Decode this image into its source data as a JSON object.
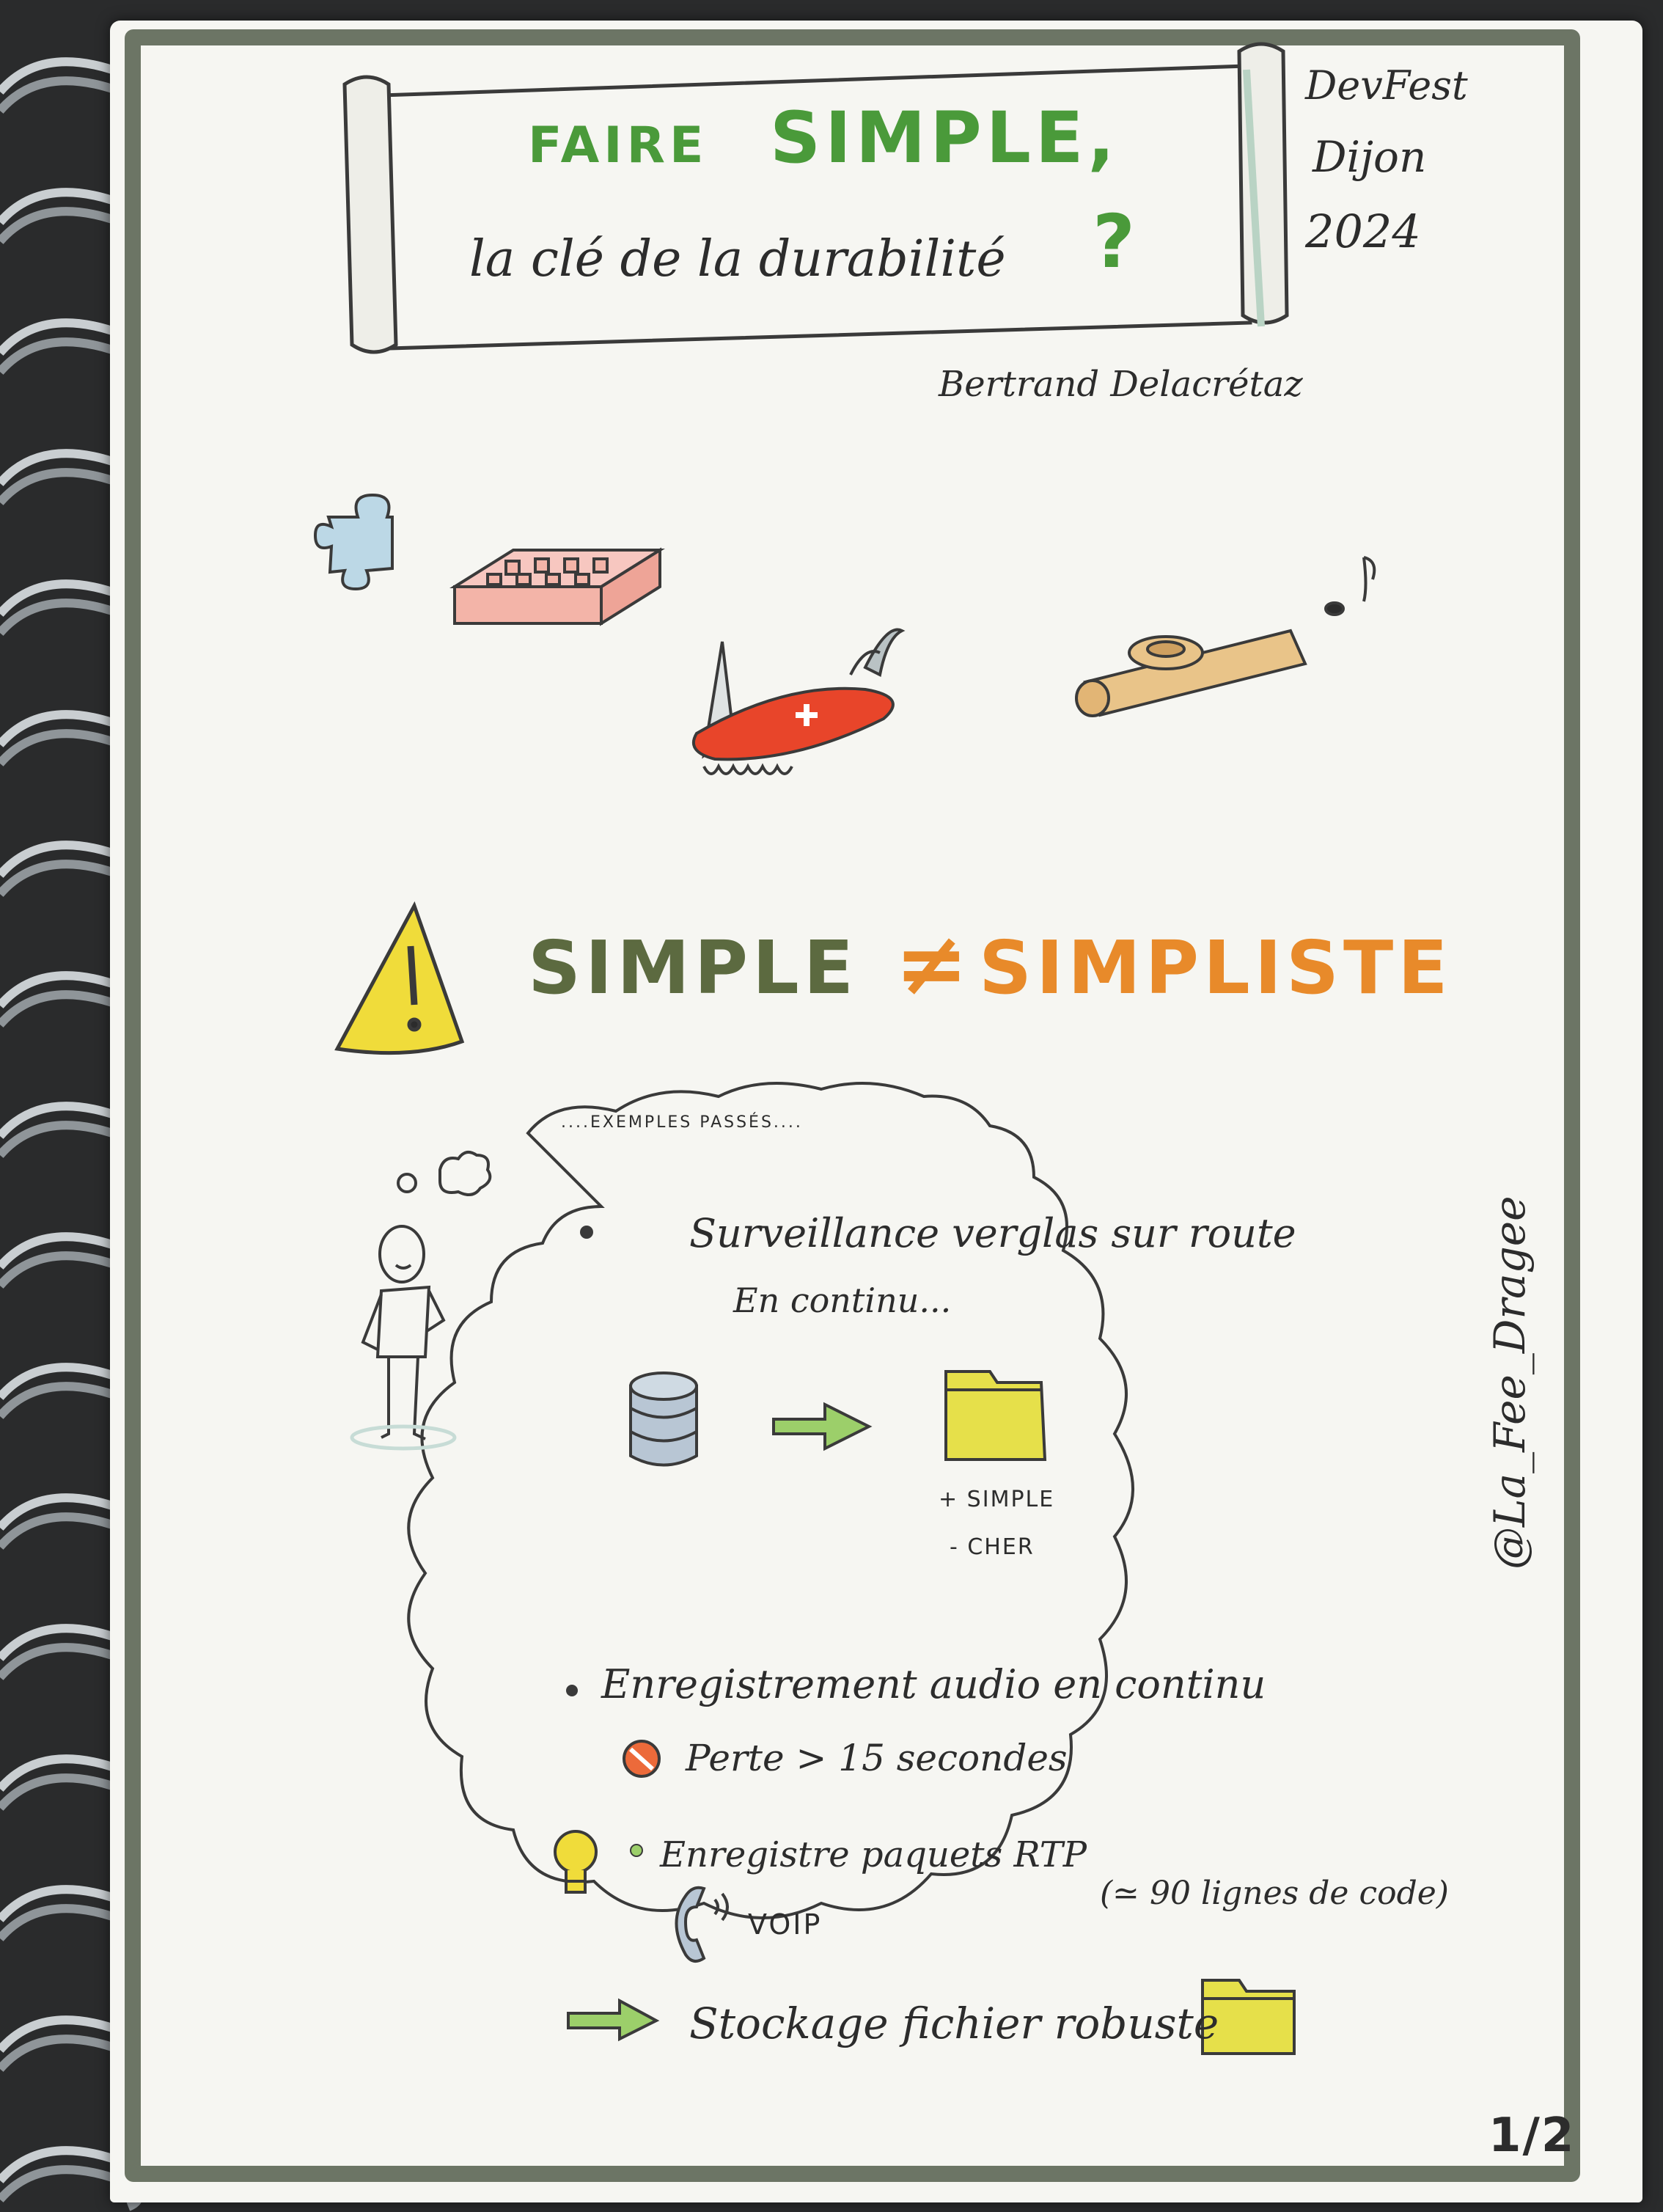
{
  "title": {
    "line1_a": "FAIRE",
    "line1_b": "SIMPLE,",
    "line2": "la clé de la durabilité",
    "question_mark": "?"
  },
  "event": {
    "line1": "DevFest",
    "line2": "Dijon",
    "line3": "2024"
  },
  "author": "Bertrand Delacrétaz",
  "credit": "@La_Fee_Dragee",
  "page_number": "1/2",
  "warning": {
    "left": "SIMPLE",
    "neq": "≠",
    "right": "SIMPLISTE"
  },
  "cloud": {
    "heading": "....EXEMPLES PASSÉS....",
    "item1": {
      "title": "Surveillance verglas sur route",
      "subtitle": "En continu...",
      "pro1": "+ SIMPLE",
      "pro2": "- CHER"
    },
    "item2": {
      "title": "Enregistrement audio en continu",
      "loss": "Perte > 15 secondes"
    },
    "item3": {
      "title": "Enregistre paquets RTP",
      "voip": "VOIP",
      "note": "(≃ 90 lignes de code)"
    },
    "item4": {
      "text": "Stockage fichier robuste"
    }
  },
  "colors": {
    "accent_green": "#4a9a3a",
    "accent_orange": "#e88a2a",
    "frame_gray": "#6c7565",
    "warning_yellow": "#f0dc3a",
    "folder_yellow": "#e6e04a",
    "knife_red": "#e8452a"
  }
}
